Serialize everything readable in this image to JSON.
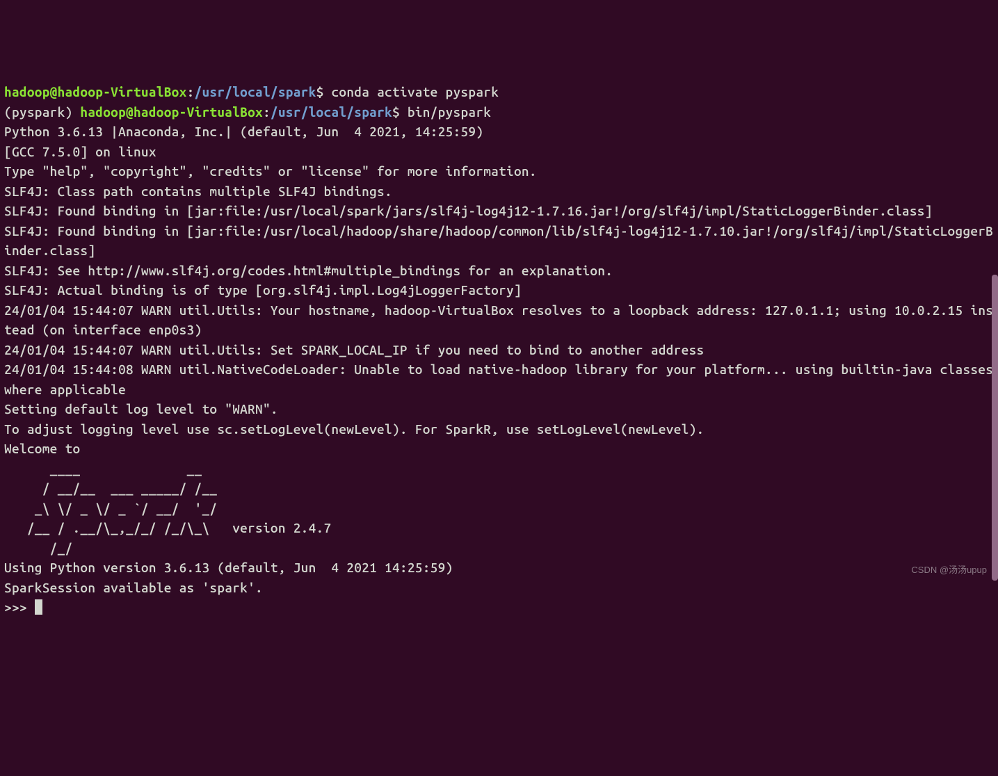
{
  "prompt1": {
    "user_host": "hadoop@hadoop-VirtualBox",
    "colon": ":",
    "path": "/usr/local/spark",
    "dollar": "$ ",
    "command": "conda activate pyspark"
  },
  "prompt2": {
    "env": "(pyspark) ",
    "user_host": "hadoop@hadoop-VirtualBox",
    "colon": ":",
    "path": "/usr/local/spark",
    "dollar": "$ ",
    "command": "bin/pyspark"
  },
  "output": {
    "l1": "Python 3.6.13 |Anaconda, Inc.| (default, Jun  4 2021, 14:25:59)",
    "l2": "[GCC 7.5.0] on linux",
    "l3": "Type \"help\", \"copyright\", \"credits\" or \"license\" for more information.",
    "l4": "SLF4J: Class path contains multiple SLF4J bindings.",
    "l5": "SLF4J: Found binding in [jar:file:/usr/local/spark/jars/slf4j-log4j12-1.7.16.jar!/org/slf4j/impl/StaticLoggerBinder.class]",
    "l6": "SLF4J: Found binding in [jar:file:/usr/local/hadoop/share/hadoop/common/lib/slf4j-log4j12-1.7.10.jar!/org/slf4j/impl/StaticLoggerBinder.class]",
    "l7": "SLF4J: See http://www.slf4j.org/codes.html#multiple_bindings for an explanation.",
    "l8": "SLF4J: Actual binding is of type [org.slf4j.impl.Log4jLoggerFactory]",
    "l9": "24/01/04 15:44:07 WARN util.Utils: Your hostname, hadoop-VirtualBox resolves to a loopback address: 127.0.1.1; using 10.0.2.15 instead (on interface enp0s3)",
    "l10": "24/01/04 15:44:07 WARN util.Utils: Set SPARK_LOCAL_IP if you need to bind to another address",
    "l11": "24/01/04 15:44:08 WARN util.NativeCodeLoader: Unable to load native-hadoop library for your platform... using builtin-java classes where applicable",
    "l12": "Setting default log level to \"WARN\".",
    "l13": "To adjust logging level use sc.setLogLevel(newLevel). For SparkR, use setLogLevel(newLevel).",
    "l14": "Welcome to",
    "ascii1": "      ____              __",
    "ascii2": "     / __/__  ___ _____/ /__",
    "ascii3": "    _\\ \\/ _ \\/ _ `/ __/  '_/",
    "ascii4": "   /__ / .__/\\_,_/_/ /_/\\_\\   version 2.4.7",
    "ascii5": "      /_/",
    "l15": "",
    "l16": "Using Python version 3.6.13 (default, Jun  4 2021 14:25:59)",
    "l17": "SparkSession available as 'spark'.",
    "repl_prompt": ">>> "
  },
  "watermark": "CSDN @汤汤upup"
}
